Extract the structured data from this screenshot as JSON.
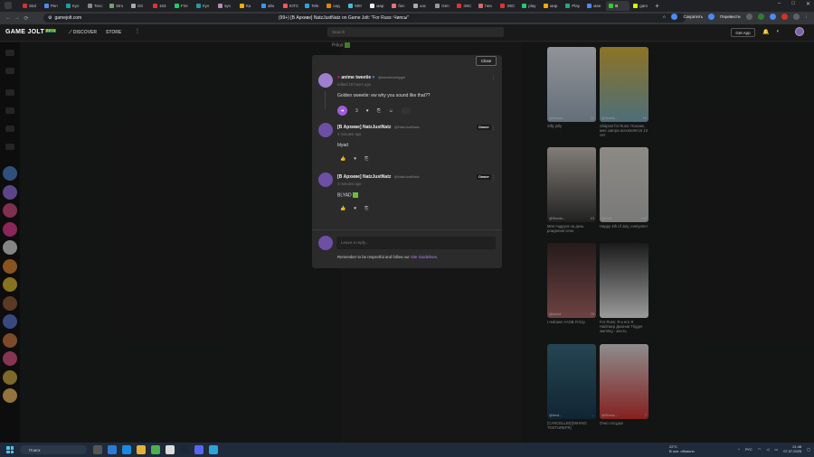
{
  "browser": {
    "tabs": [
      "Stal",
      "Реп",
      "Кул",
      "Тесс",
      "Stro",
      "Git",
      "163",
      "Fire",
      "Кул",
      "syn",
      "Ка",
      "alto",
      "ЮТС",
      "Tele",
      "сид",
      "600",
      "мар",
      "бес",
      "кас",
      "Gen",
      "ЭКС",
      "hea",
      "ЭКС",
      "play",
      "мар",
      "Play",
      "ман",
      "В",
      "gam"
    ],
    "active_tab": "В",
    "url": "gamejolt.com",
    "page_title": "(99+) [В Архиве] NatzJustNatz on Game Jolt: \"For Russ: Чипсы\"",
    "buttons": {
      "shorten": "Сократить",
      "translate": "Перевести"
    }
  },
  "site": {
    "logo": "GAME JOLT",
    "logo_badge": "BETA",
    "nav": [
      "DISCOVER",
      "STORE"
    ],
    "search_placeholder": "Search",
    "get_app": "Get App"
  },
  "background": {
    "prikol": "Prikol"
  },
  "modal": {
    "close_label": "Close",
    "comments": [
      {
        "author": "anime tweetie",
        "handle": "@tweetiebeliygirl",
        "time": "edited 19 hours ago",
        "body": "Golden sweetie: ew why you sound like that??",
        "likes": "3",
        "owner": false
      },
      {
        "author": "[В Архиве] NatzJustNatz",
        "handle": "@NatzJustNatz",
        "time": "4 minutes ago",
        "body": "blyad",
        "owner_label": "Owner"
      },
      {
        "author": "[В Архиве] NatzJustNatz",
        "handle": "@NatzJustNatz",
        "time": "3 minutes ago",
        "body": "BLYAD",
        "owner_label": "Owner"
      }
    ],
    "reply_placeholder": "Leave a reply...",
    "guideline_text": "Remember to be respectful and follow our",
    "guideline_link": "Site Guidelines",
    "guideline_end": "."
  },
  "grid": [
    {
      "author": "@Shedo...",
      "likes": "11",
      "caption": "Silly jolly"
    },
    {
      "author": "@Shedo...",
      "likes": "10",
      "caption": "Shitpost for Russ: Похоже, мне завтра исполняется 13 лет"
    },
    {
      "author": "@Shedo...",
      "likes": "13",
      "caption": "Моя подруга на день рождения сено"
    },
    {
      "author": "@Cele...",
      "likes": "142",
      "caption": "Happy 4th of July, everyone!"
    },
    {
      "author": "@kchr4",
      "likes": "79",
      "caption": "I redrawn AASB Frizzy"
    },
    {
      "author": "@Shedo...",
      "likes": "10",
      "caption": "For Russ: Я и его Я Найтмер Джонни Trigger warning - жесть"
    },
    {
      "author": "@best...",
      "likes": "...",
      "caption": "(CANCELLED)(WHING TOXTUREFR)"
    },
    {
      "author": "@Shedo...",
      "likes": "7",
      "caption": "Очко сосудок"
    }
  ],
  "taskbar": {
    "search": "Поиск",
    "weather_temp": "22°C",
    "weather_desc": "В осн. облачно",
    "lang": "РУС",
    "time": "21:48",
    "date": "07.07.2025"
  },
  "colors": {
    "accent_purple": "#a05bd8",
    "link_purple": "#b583ff",
    "brand_green": "#ccff00",
    "modal_bg": "#2b2b2b"
  }
}
